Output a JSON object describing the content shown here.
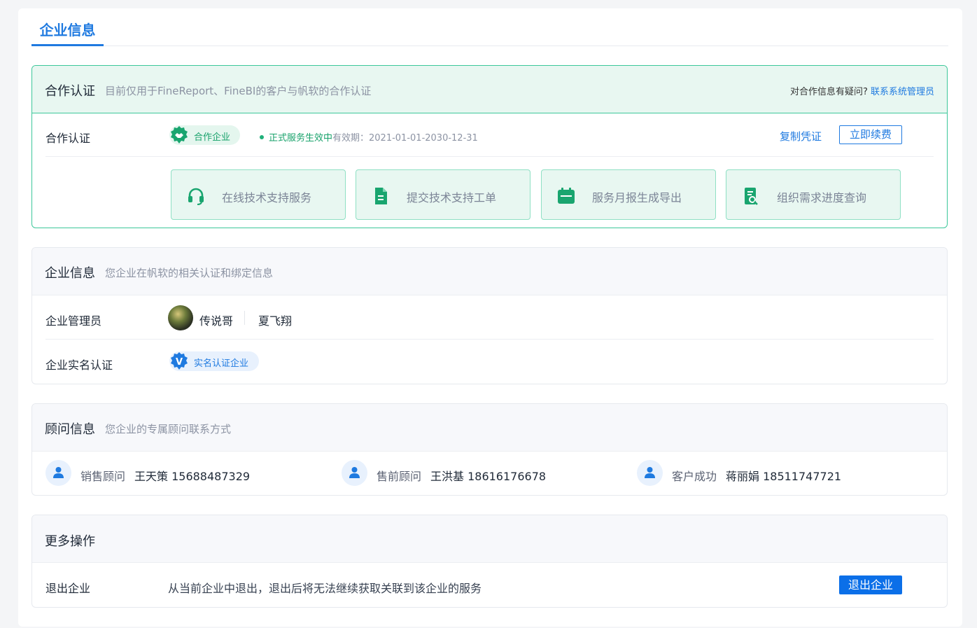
{
  "tabs": {
    "active": "企业信息"
  },
  "coop": {
    "title": "合作认证",
    "subtitle": "目前仅用于FineReport、FineBI的客户与帆软的合作认证",
    "help_text": "对合作信息有疑问?",
    "help_link": "联系系统管理员",
    "row_label": "合作认证",
    "badge": "合作企业",
    "status_ok": "正式服务生效中",
    "validity": "有效期：2021-01-01-2030-12-31",
    "copy_link": "复制凭证",
    "renew_button": "立即续费",
    "services": [
      {
        "label": "在线技术支持服务",
        "icon": "headset-icon"
      },
      {
        "label": "提交技术支持工单",
        "icon": "document-icon"
      },
      {
        "label": "服务月报生成导出",
        "icon": "calendar-icon"
      },
      {
        "label": "组织需求进度查询",
        "icon": "document-search-icon"
      }
    ]
  },
  "enterprise": {
    "title": "企业信息",
    "subtitle": "您企业在帆软的相关认证和绑定信息",
    "admin_label": "企业管理员",
    "admin_nick": "传说哥",
    "admin_name": "夏飞翔",
    "realname_label": "企业实名认证",
    "realname_badge": "实名认证企业",
    "realname_mark": "V"
  },
  "advisors": {
    "title": "顾问信息",
    "subtitle": "您企业的专属顾问联系方式",
    "items": [
      {
        "role": "销售顾问",
        "contact": "王天策 15688487329"
      },
      {
        "role": "售前顾问",
        "contact": "王洪基 18616176678"
      },
      {
        "role": "客户成功",
        "contact": "蒋丽娟 18511747721"
      }
    ]
  },
  "more": {
    "title": "更多操作",
    "quit_label": "退出企业",
    "quit_desc": "从当前企业中退出，退出后将无法继续获取关联到该企业的服务",
    "quit_button": "退出企业"
  },
  "colors": {
    "primary": "#1f7ae0",
    "green": "#18a26b",
    "green_border": "#3cc79a"
  }
}
